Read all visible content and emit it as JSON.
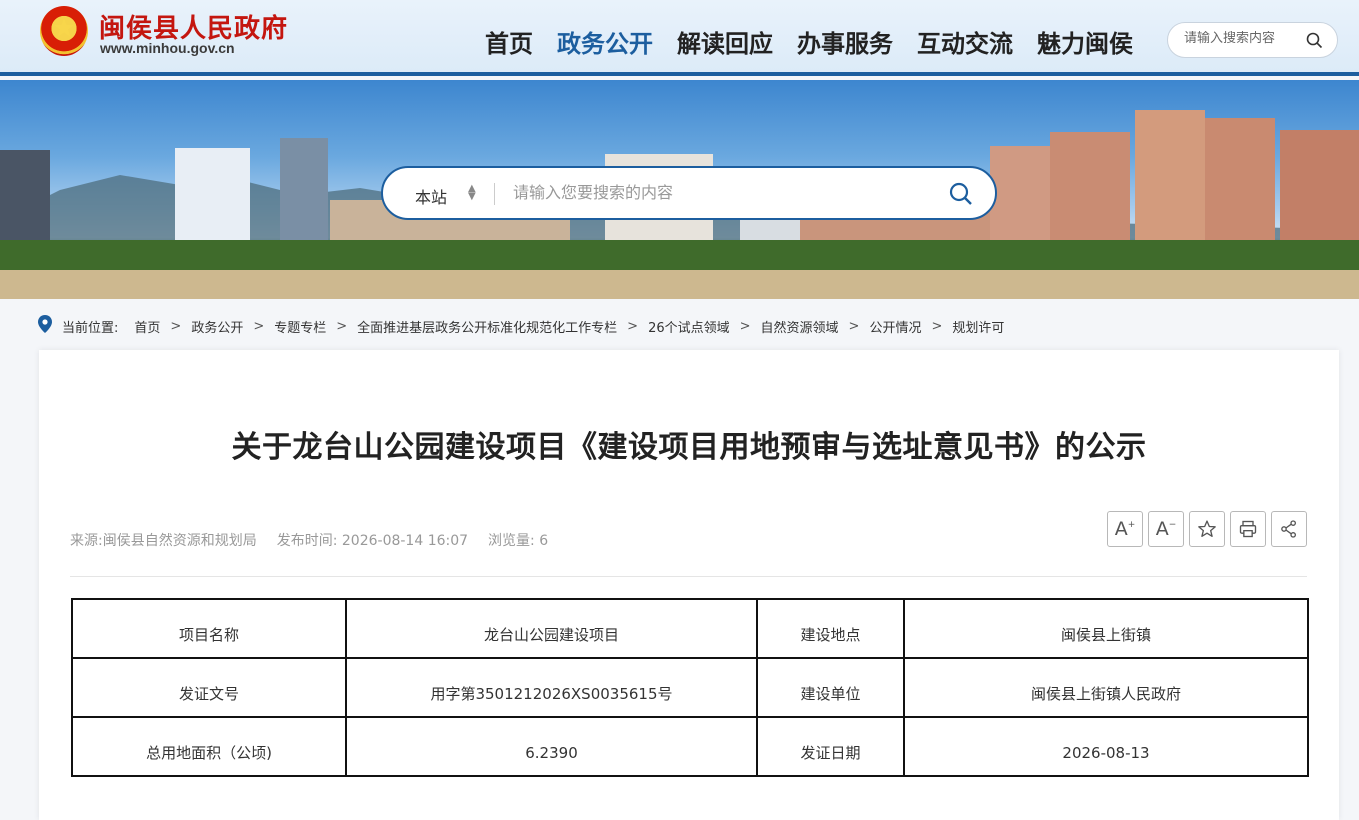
{
  "header": {
    "site_name": "闽侯县人民政府",
    "site_url": "www.minhou.gov.cn",
    "nav": [
      {
        "label": "首页",
        "active": false
      },
      {
        "label": "政务公开",
        "active": true
      },
      {
        "label": "解读回应",
        "active": false
      },
      {
        "label": "办事服务",
        "active": false
      },
      {
        "label": "互动交流",
        "active": false
      },
      {
        "label": "魅力闽侯",
        "active": false
      }
    ],
    "search_placeholder": "请输入搜索内容"
  },
  "banner": {
    "scope": "本站",
    "search_placeholder": "请输入您要搜索的内容"
  },
  "breadcrumb": {
    "label": "当前位置:",
    "items": [
      "首页",
      "政务公开",
      "专题专栏",
      "全面推进基层政务公开标准化规范化工作专栏",
      "26个试点领域",
      "自然资源领域",
      "公开情况",
      "规划许可"
    ]
  },
  "article": {
    "title": "关于龙台山公园建设项目《建设项目用地预审与选址意见书》的公示",
    "source": "来源:闽侯县自然资源和规划局",
    "publish_time": "发布时间: 2026-08-14 16:07",
    "views": "浏览量:  6",
    "tools": [
      {
        "label": "A",
        "sup": "+",
        "icon": "font-increase-icon"
      },
      {
        "label": "A",
        "sup": "−",
        "icon": "font-decrease-icon"
      },
      {
        "icon": "star-icon"
      },
      {
        "icon": "print-icon"
      },
      {
        "icon": "share-icon"
      }
    ],
    "table": [
      [
        "项目名称",
        "龙台山公园建设项目",
        "建设地点",
        "闽侯县上街镇"
      ],
      [
        "发证文号",
        "用字第3501212026XS0035615号",
        "建设单位",
        "闽侯县上街镇人民政府"
      ],
      [
        "总用地面积（公顷)",
        "6.2390",
        "发证日期",
        "2026-08-13"
      ]
    ]
  },
  "colors": {
    "brand_blue": "#1c5e9f",
    "site_red": "#c4160f"
  }
}
